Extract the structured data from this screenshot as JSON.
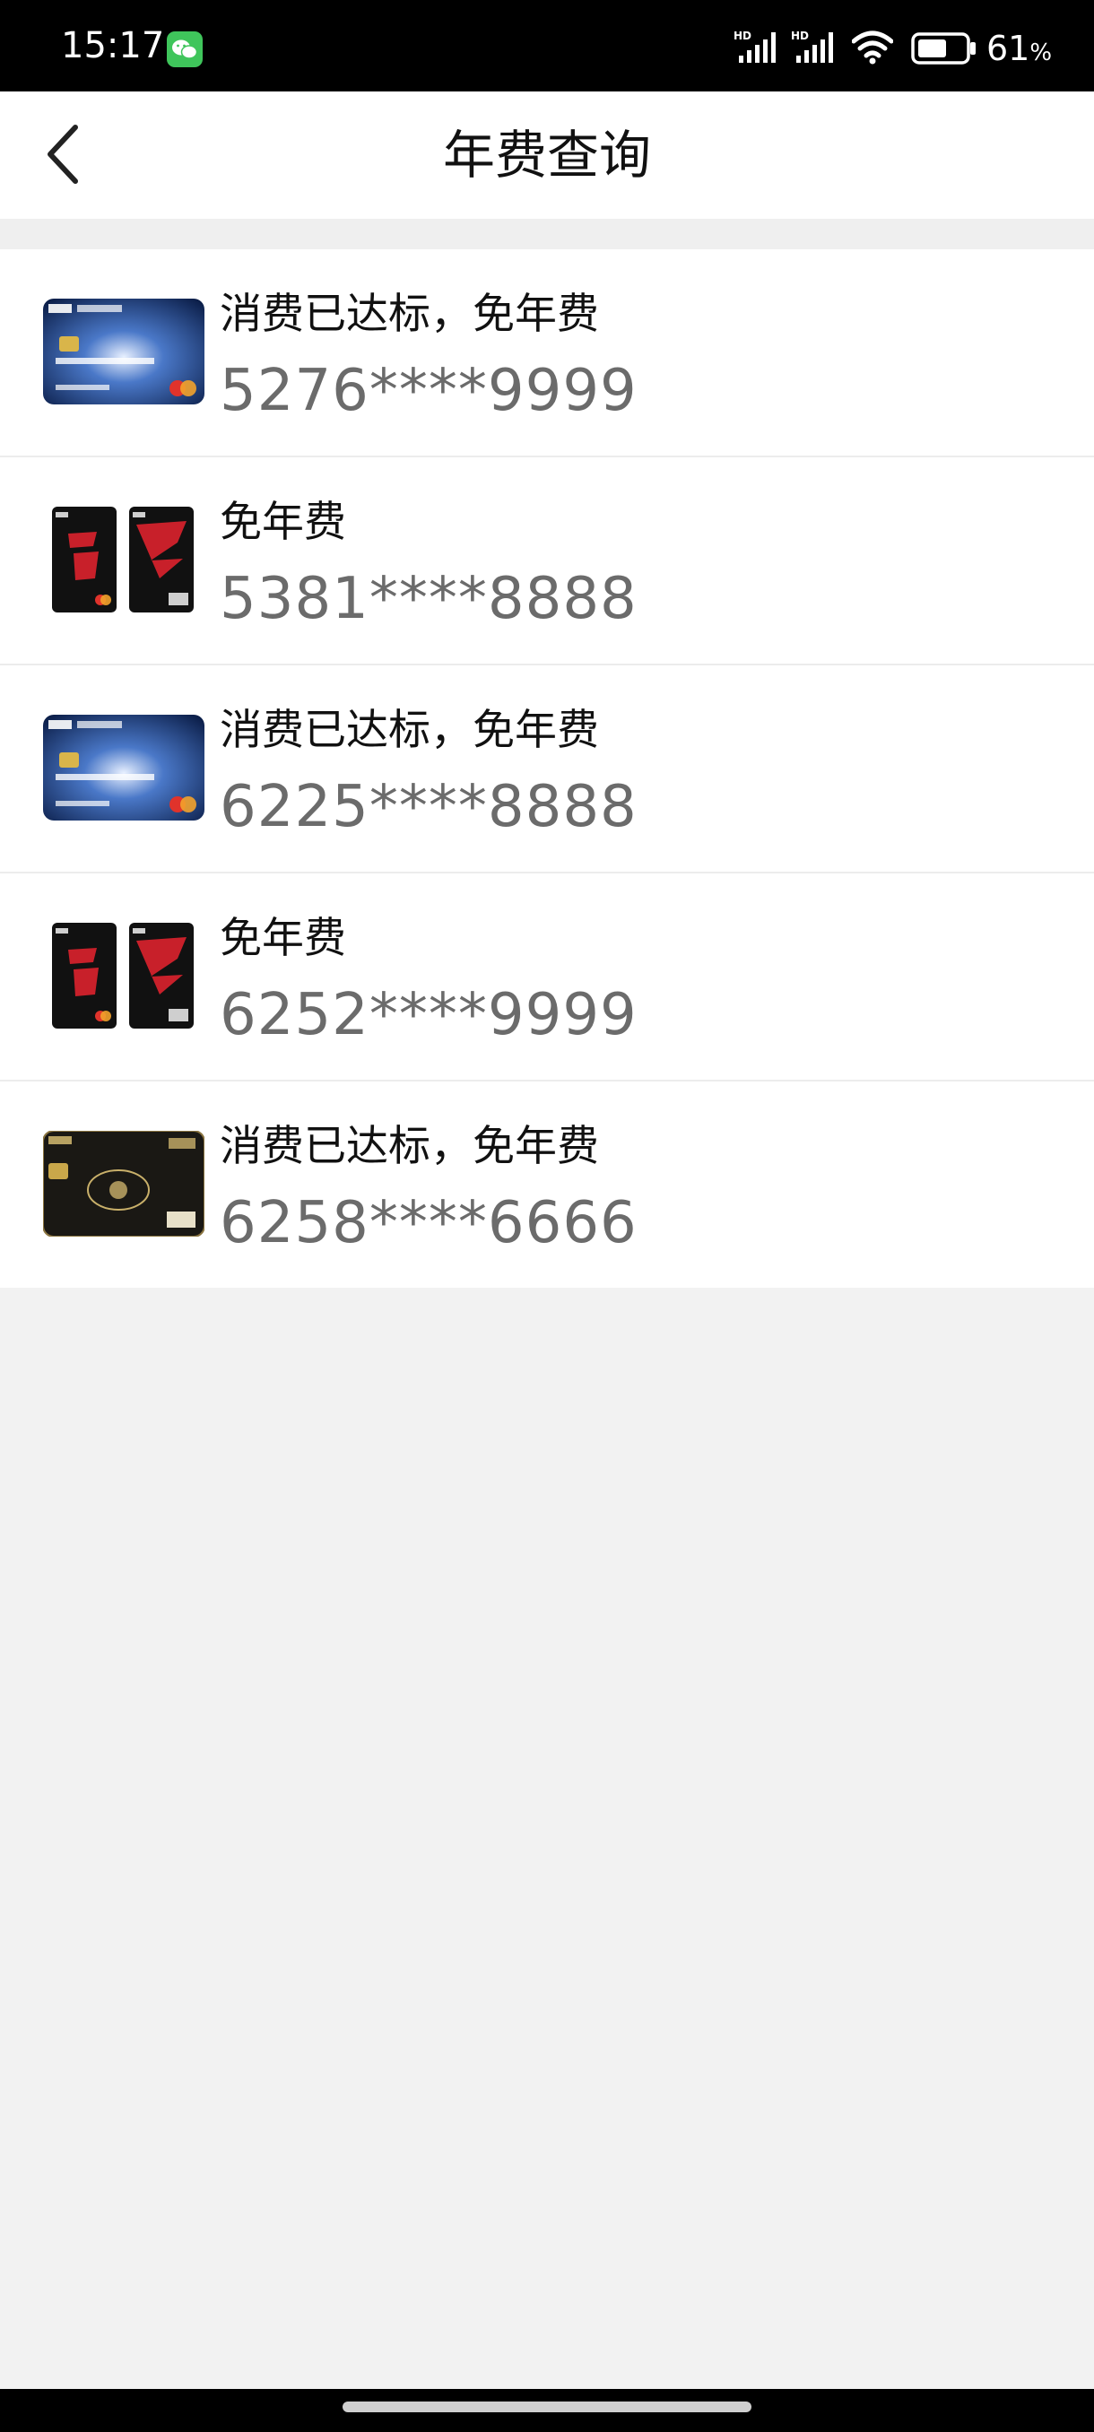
{
  "status_bar": {
    "time": "15:17",
    "battery_percent": "61",
    "battery_unit": "%",
    "network_labels": [
      "HD",
      "HD"
    ],
    "icons": [
      "wechat-icon",
      "signal-icon",
      "signal-icon",
      "wifi-icon",
      "battery-icon"
    ],
    "battery_level": 0.61
  },
  "header": {
    "title": "年费查询",
    "back_icon": "chevron-left-icon"
  },
  "cards": [
    {
      "status": "消费已达标，免年费",
      "number": "5276****9999",
      "art": "icbc-blue-platinum"
    },
    {
      "status": "免年费",
      "number": "5381****8888",
      "art": "fendou-black-pair"
    },
    {
      "status": "消费已达标，免年费",
      "number": "6225****8888",
      "art": "icbc-blue-platinum"
    },
    {
      "status": "免年费",
      "number": "6252****9999",
      "art": "fendou-black-pair"
    },
    {
      "status": "消费已达标，免年费",
      "number": "6258****6666",
      "art": "icbc-black-gold"
    }
  ],
  "colors": {
    "background": "#f2f2f2",
    "card_number": "#6b6b6b",
    "status_text": "#111111"
  }
}
